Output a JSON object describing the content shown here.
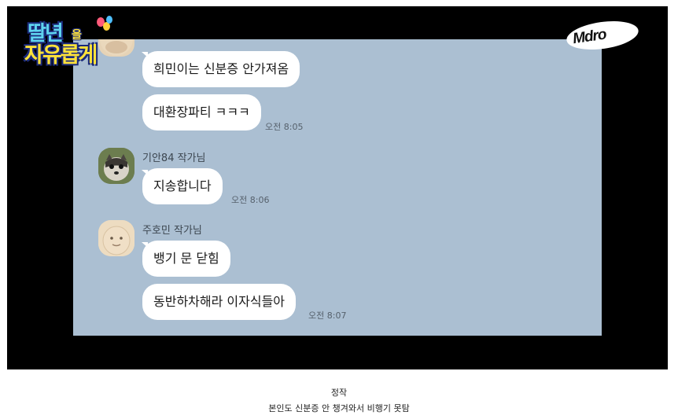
{
  "show_logo": {
    "line1": "딸년",
    "small": "을",
    "line2": "자유롭게"
  },
  "brand_logo": "Mdro",
  "chat": {
    "messages_a": [
      "희민이는 신분증 안가져옴",
      "대환장파티 ㅋㅋㅋ"
    ],
    "time_a": "오전 8:05",
    "user_b": {
      "name": "기안84 작가님",
      "message": "지송합니다",
      "time": "오전 8:06"
    },
    "user_c": {
      "name": "주호민 작가님",
      "messages": [
        "뱅기 문 닫힘",
        "동반하차해라 이자식들아"
      ],
      "time": "오전 8:07"
    }
  },
  "caption": {
    "line1": "정작",
    "line2": "본인도 신분증 안 챙겨와서 비행기 못탐"
  },
  "colors": {
    "chat_background": "#abbfd2",
    "bubble": "#ffffff",
    "frame": "#000000"
  }
}
